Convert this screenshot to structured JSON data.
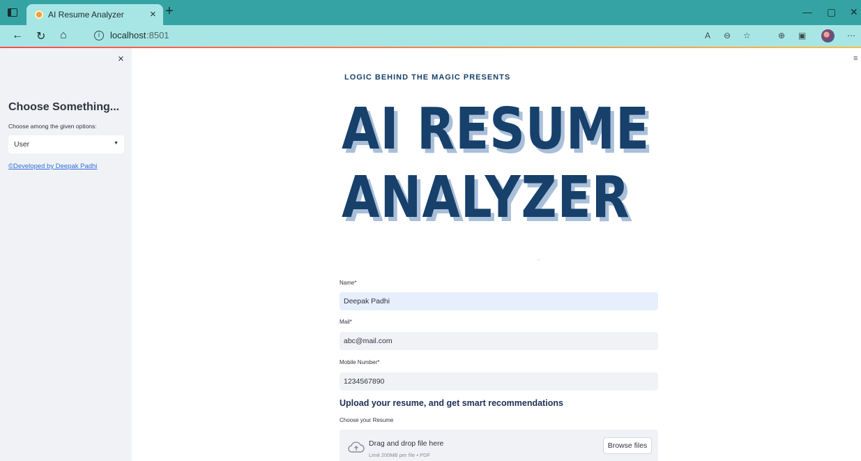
{
  "browser": {
    "tab_title": "AI Resume Analyzer",
    "tab_close": "×",
    "new_tab": "+",
    "url_host": "localhost",
    "url_port": ":8501",
    "minimize": "—",
    "restore": "▢",
    "close": "✕"
  },
  "sidebar": {
    "close": "×",
    "title": "Choose Something...",
    "subtitle": "Choose among the given options:",
    "select_value": "User",
    "select_caret": "▼",
    "dev_link": "©Developed by Deepak Padhi"
  },
  "logo": {
    "presents": "LOGIC BEHIND THE MAGIC PRESENTS",
    "line1": "AI RESUME",
    "line2": "ANALYZER",
    "colors": {
      "primary": "#17406b",
      "shadow": "#a9bfd9"
    }
  },
  "form": {
    "name_label": "Name*",
    "name_value": "Deepak Padhi",
    "mail_label": "Mail*",
    "mail_value": "abc@mail.com",
    "mobile_label": "Mobile Number*",
    "mobile_value": "1234567890",
    "upload_heading": "Upload your resume, and get smart recommendations",
    "resume_label": "Choose your Resume",
    "drop_main": "Drag and drop file here",
    "drop_limit": "Limit 200MB per file • PDF",
    "browse_label": "Browse files"
  },
  "icons": [
    "sidebar-toggle-icon",
    "favicon-icon",
    "back-arrow-icon",
    "refresh-icon",
    "home-icon",
    "info-icon",
    "read-aloud-icon",
    "zoom-icon",
    "favorites-icon",
    "collections-icon",
    "screenshot-icon",
    "profile-avatar-icon",
    "more-icon",
    "hamburger-menu-icon",
    "cloud-upload-icon"
  ]
}
